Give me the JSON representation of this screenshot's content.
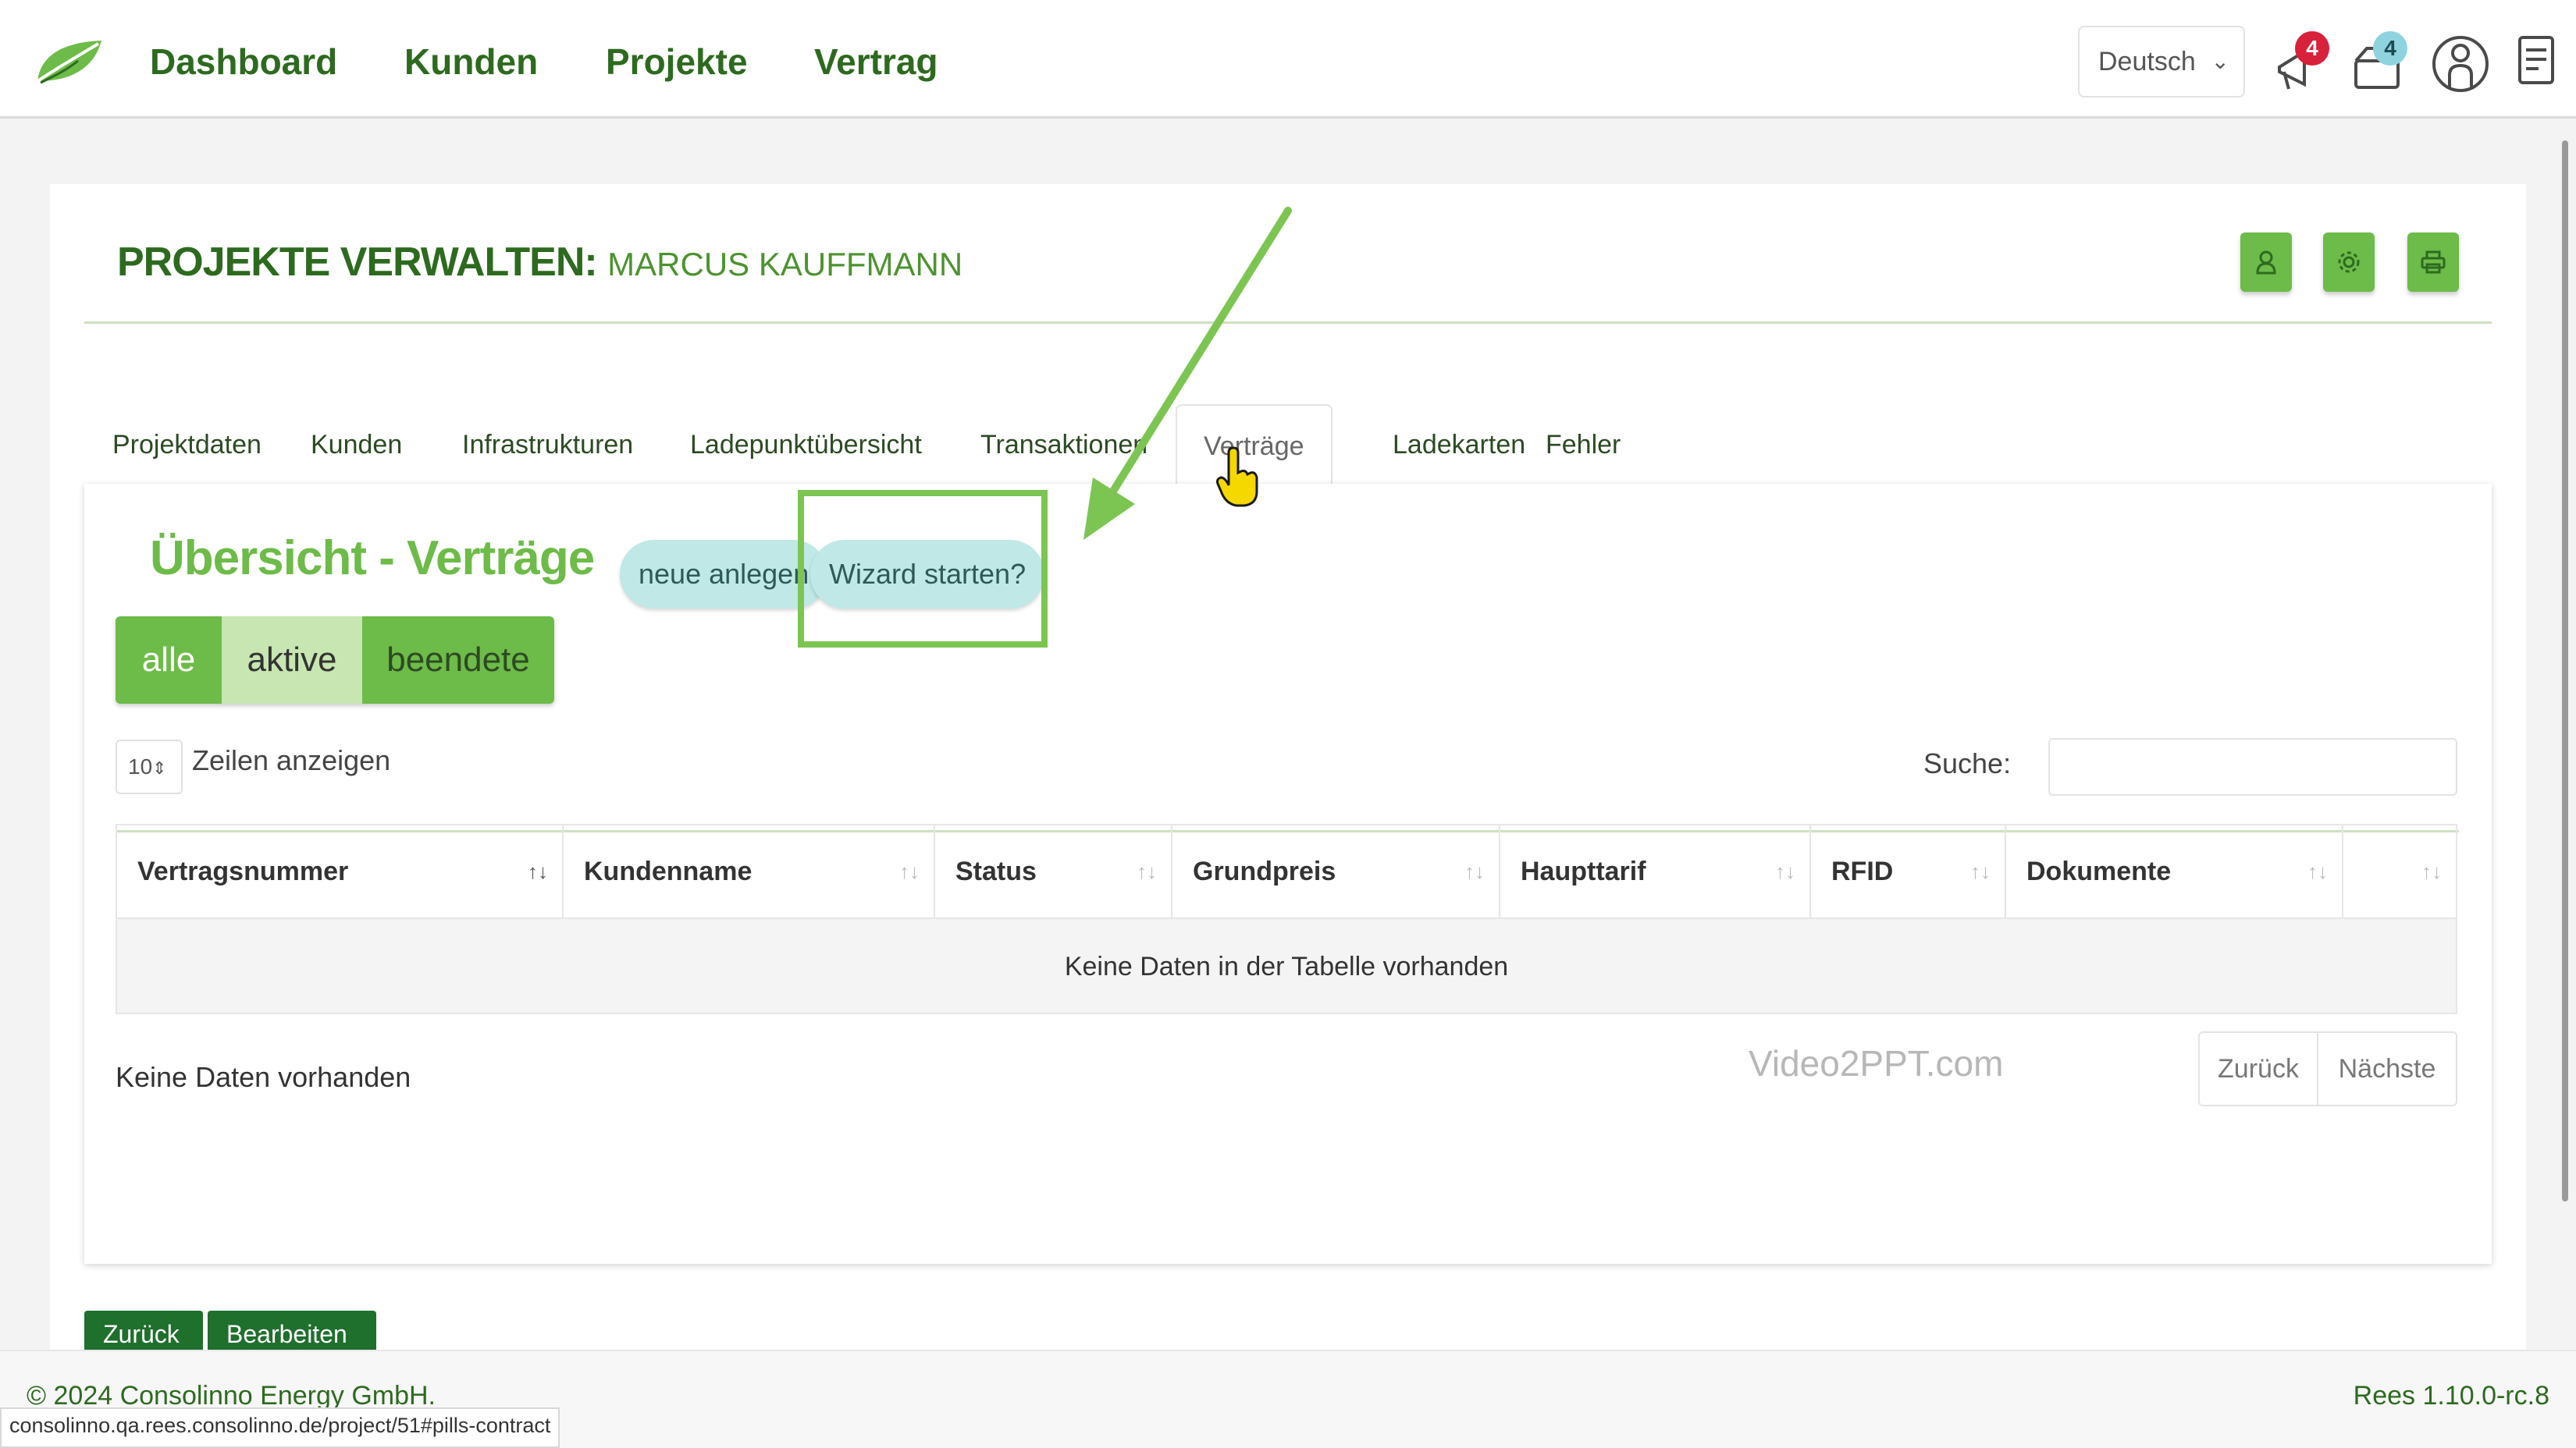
{
  "nav": {
    "links": [
      "Dashboard",
      "Kunden",
      "Projekte",
      "Vertrag"
    ],
    "language": "Deutsch",
    "notifications_count": "4",
    "messages_count": "4"
  },
  "page": {
    "title": "PROJEKTE VERWALTEN:",
    "subtitle": "MARCUS KAUFFMANN"
  },
  "tabs": [
    "Projektdaten",
    "Kunden",
    "Infrastrukturen",
    "Ladepunktübersicht",
    "Transaktionen",
    "Verträge",
    "Ladekarten",
    "Fehler"
  ],
  "panel": {
    "title": "Übersicht - Verträge",
    "new_button": "neue anlegen",
    "wizard_button": "Wizard starten?"
  },
  "filters": [
    "alle",
    "aktive",
    "beendete"
  ],
  "table": {
    "rows_value": "10",
    "rows_label": "Zeilen anzeigen",
    "search_label": "Suche:",
    "columns": [
      "Vertragsnummer",
      "Kundenname",
      "Status",
      "Grundpreis",
      "Haupttarif",
      "RFID",
      "Dokumente",
      ""
    ],
    "empty_text": "Keine Daten in der Tabelle vorhanden",
    "info": "Keine Daten vorhanden",
    "prev": "Zurück",
    "next": "Nächste"
  },
  "actions": {
    "back": "Zurück",
    "edit": "Bearbeiten"
  },
  "watermark": "Video2PPT.com",
  "footer": {
    "copyright": "© 2024 Consolinno Energy GmbH.",
    "version": "Rees 1.10.0-rc.8",
    "status_url": "consolinno.qa.rees.consolinno.de/project/51#pills-contract"
  },
  "colors": {
    "brand_dark": "#2d6a1f",
    "brand_green": "#6dbb48",
    "pill_teal": "#bfe8e6",
    "highlight": "#7cc552"
  }
}
